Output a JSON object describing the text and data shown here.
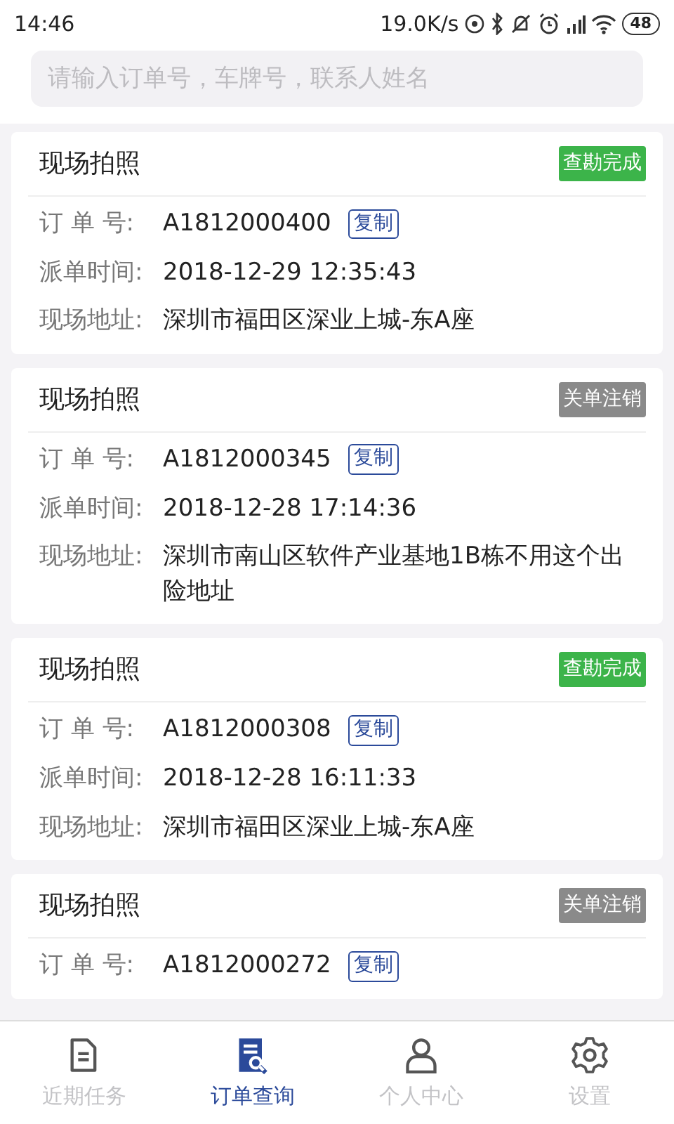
{
  "status_bar": {
    "time": "14:46",
    "net_speed": "19.0K/s",
    "battery": "48"
  },
  "search": {
    "placeholder": "请输入订单号，车牌号，联系人姓名"
  },
  "orders": [
    {
      "title": "现场拍照",
      "status": "查勘完成",
      "color": "#3cb44a",
      "fields": [
        {
          "label": "订 单 号:",
          "value": "A1812000400",
          "copy": "复制"
        },
        {
          "label": "派单时间:",
          "value": "2018-12-29 12:35:43"
        },
        {
          "label": "现场地址:",
          "value": "深圳市福田区深业上城-东A座"
        }
      ]
    },
    {
      "title": "现场拍照",
      "status": "关单注销",
      "color": "#8a8a8a",
      "fields": [
        {
          "label": "订 单 号:",
          "value": "A1812000345",
          "copy": "复制"
        },
        {
          "label": "派单时间:",
          "value": "2018-12-28 17:14:36"
        },
        {
          "label": "现场地址:",
          "value": "深圳市南山区软件产业基地1B栋不用这个出险地址"
        }
      ]
    },
    {
      "title": "现场拍照",
      "status": "查勘完成",
      "color": "#3cb44a",
      "fields": [
        {
          "label": "订 单 号:",
          "value": "A1812000308",
          "copy": "复制"
        },
        {
          "label": "派单时间:",
          "value": "2018-12-28 16:11:33"
        },
        {
          "label": "现场地址:",
          "value": "深圳市福田区深业上城-东A座"
        }
      ]
    },
    {
      "title": "现场拍照",
      "status": "关单注销",
      "color": "#8a8a8a",
      "fields": [
        {
          "label": "订 单 号:",
          "value": "A1812000272",
          "copy": "复制"
        }
      ]
    }
  ],
  "tabs": [
    {
      "label": "近期任务",
      "kind": "doc",
      "selected": false
    },
    {
      "label": "订单查询",
      "kind": "search",
      "selected": true
    },
    {
      "label": "个人中心",
      "kind": "person",
      "selected": false
    },
    {
      "label": "设置",
      "kind": "gear",
      "selected": false
    }
  ]
}
